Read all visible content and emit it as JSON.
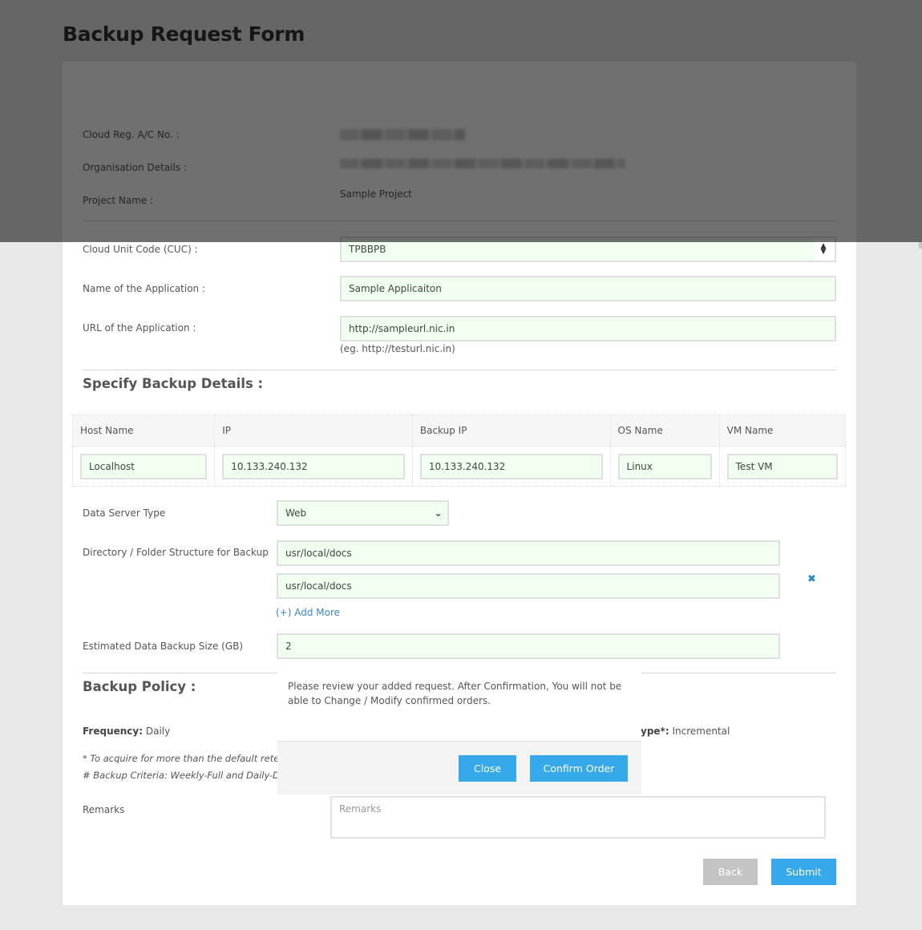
{
  "page": {
    "title": "Backup Request Form"
  },
  "account": {
    "cloud_reg_label": "Cloud Reg. A/C No. :",
    "org_details_label": "Organisation Details :",
    "project_name_label": "Project Name :",
    "project_name_value": "Sample Project"
  },
  "application": {
    "cuc_label": "Cloud Unit Code (CUC) :",
    "cuc_value": "TPBBPB",
    "name_label": "Name of the Application :",
    "name_value": "Sample Applicaiton",
    "url_label": "URL of the Application :",
    "url_value": "http://sampleurl.nic.in",
    "url_hint": "(eg. http://testurl.nic.in)"
  },
  "backup_details": {
    "heading": "Specify Backup Details :",
    "columns": [
      "Host Name",
      "IP",
      "Backup IP",
      "OS Name",
      "VM Name"
    ],
    "rows": [
      [
        "Localhost",
        "10.133.240.132",
        "10.133.240.132",
        "Linux",
        "Test VM"
      ]
    ],
    "server_type_label": "Data Server Type",
    "server_type_value": "Web",
    "directory_label": "Directory / Folder Structure for Backup",
    "directories": [
      "usr/local/docs",
      "usr/local/docs"
    ],
    "add_more_label": "(+) Add More",
    "remove_icon": "close-icon",
    "size_label": "Estimated Data Backup Size (GB)",
    "size_value": "2"
  },
  "policy": {
    "heading": "Backup Policy :",
    "frequency_label": "Frequency:",
    "frequency_value": "Daily",
    "type_label_partial": "ype*:",
    "type_value": "Incremental",
    "note_retention": "* To acquire for more than the default retention",
    "note_criteria": "# Backup Criteria: Weekly-Full and Daily-Differential"
  },
  "remarks": {
    "label": "Remarks",
    "placeholder": "Remarks"
  },
  "actions": {
    "back_label": "Back",
    "submit_label": "Submit"
  },
  "modal": {
    "message": "Please review your added request. After Confirmation, You will not be able to Change / Modify confirmed orders.",
    "close_label": "Close",
    "confirm_label": "Confirm Order"
  },
  "colors": {
    "primary_button": "#36a9ea",
    "secondary_button": "#c4c4c4",
    "input_background": "#f1fff1",
    "link": "#3a87c0"
  }
}
